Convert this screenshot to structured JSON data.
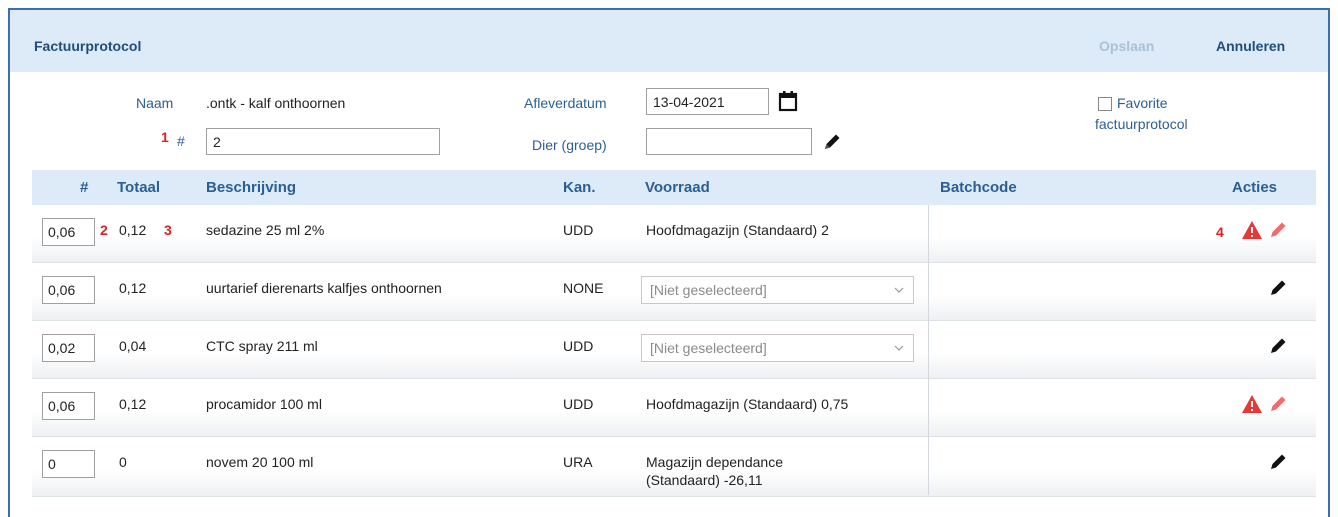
{
  "header": {
    "title": "Factuurprotocol",
    "save_label": "Opslaan",
    "cancel_label": "Annuleren"
  },
  "form": {
    "naam_label": "Naam",
    "naam_value": ".ontk - kalf onthoornen",
    "number_label": "#",
    "number_value": "2",
    "afleverdatum_label": "Afleverdatum",
    "afleverdatum_value": "13-04-2021",
    "dier_label": "Dier (groep)",
    "dier_value": "",
    "favorite_line1": "Favorite",
    "favorite_line2": "factuurprotocol",
    "favorite_checked": false
  },
  "markers": {
    "m1": "1",
    "m2": "2",
    "m3": "3",
    "m4": "4"
  },
  "table": {
    "columns": [
      "#",
      "Totaal",
      "Beschrijving",
      "Kan.",
      "Voorraad",
      "Batchcode",
      "Acties"
    ],
    "rows": [
      {
        "qty": "0,06",
        "totaal": "0,12",
        "beschrijving": "sedazine 25 ml 2%",
        "kanaal": "UDD",
        "voorraad_line1": "Hoofdmagazijn (Standaard) 2",
        "voorraad_line2": "",
        "select": "",
        "warning": true,
        "edit_color": "#f26b6b"
      },
      {
        "qty": "0,06",
        "totaal": "0,12",
        "beschrijving": "uurtarief dierenarts kalfjes onthoornen",
        "kanaal": "NONE",
        "voorraad_line1": "",
        "voorraad_line2": "",
        "select": "[Niet geselecteerd]",
        "warning": false,
        "edit_color": "#111111"
      },
      {
        "qty": "0,02",
        "totaal": "0,04",
        "beschrijving": "CTC spray 211 ml",
        "kanaal": "UDD",
        "voorraad_line1": "",
        "voorraad_line2": "",
        "select": "[Niet geselecteerd]",
        "warning": false,
        "edit_color": "#111111"
      },
      {
        "qty": "0,06",
        "totaal": "0,12",
        "beschrijving": "procamidor 100 ml",
        "kanaal": "UDD",
        "voorraad_line1": "Hoofdmagazijn (Standaard) 0,75",
        "voorraad_line2": "",
        "select": "",
        "warning": true,
        "edit_color": "#f26b6b"
      },
      {
        "qty": "0",
        "totaal": "0",
        "beschrijving": "novem 20 100 ml",
        "kanaal": "URA",
        "voorraad_line1": "Magazijn dependance",
        "voorraad_line2": "(Standaard) -26,11",
        "select": "",
        "warning": false,
        "edit_color": "#111111"
      }
    ]
  },
  "colors": {
    "header_bg": "#dcebf7",
    "accent": "#1f4e79",
    "label_blue": "#2b5f93",
    "warning_red": "#e53935",
    "marker_red": "#e02020"
  },
  "icons": {
    "calendar": "calendar-icon",
    "pencil": "pencil-icon",
    "warning": "warning-icon",
    "chevron": "chevron-down-icon"
  }
}
